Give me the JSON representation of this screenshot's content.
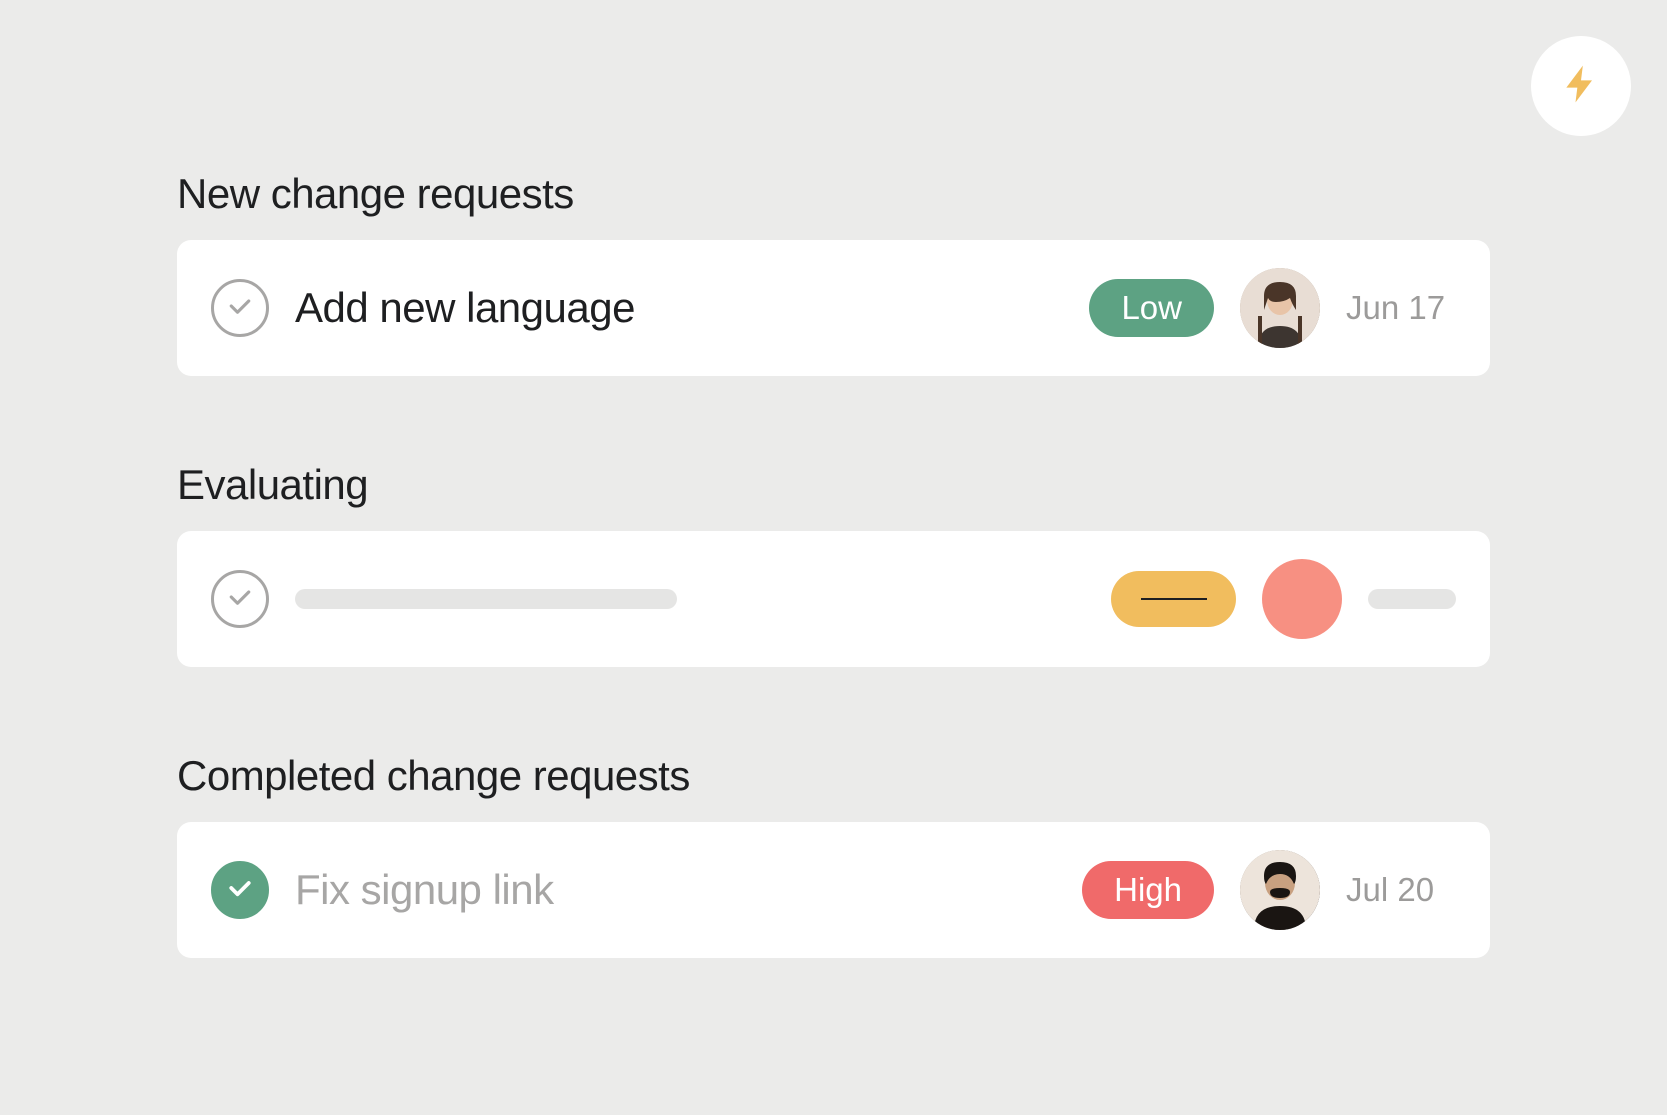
{
  "sections": {
    "new": {
      "title": "New change requests",
      "task": {
        "title": "Add new language",
        "priority": "Low",
        "date": "Jun 17"
      }
    },
    "evaluating": {
      "title": "Evaluating"
    },
    "completed": {
      "title": "Completed change requests",
      "task": {
        "title": "Fix signup link",
        "priority": "High",
        "date": "Jul 20"
      }
    }
  }
}
